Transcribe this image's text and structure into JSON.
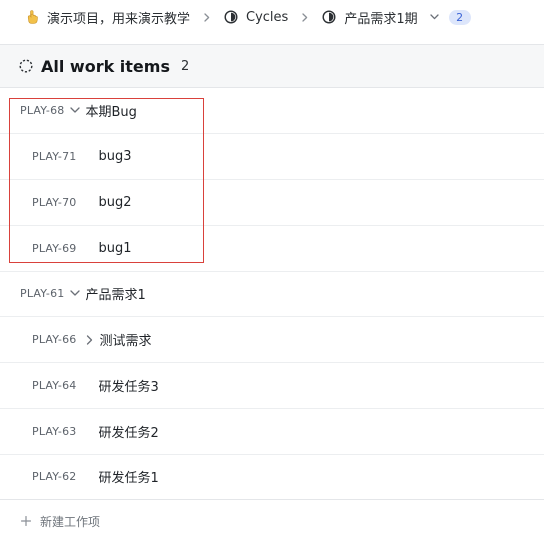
{
  "breadcrumb": {
    "project_icon": "hand-icon",
    "project": "演示项目，用来演示教学",
    "cycles": "Cycles",
    "cycle_name": "产品需求1期",
    "cycle_count": "2"
  },
  "header": {
    "title": "All work items",
    "count": "2"
  },
  "rows": [
    {
      "key": "PLAY-68",
      "label": "本期Bug",
      "toggle": "chevron-down"
    },
    {
      "key": "PLAY-71",
      "label": "bug3"
    },
    {
      "key": "PLAY-70",
      "label": "bug2"
    },
    {
      "key": "PLAY-69",
      "label": "bug1"
    },
    {
      "key": "PLAY-61",
      "label": "产品需求1",
      "toggle": "chevron-down"
    },
    {
      "key": "PLAY-66",
      "label": "测试需求",
      "toggle": "chevron-right"
    },
    {
      "key": "PLAY-64",
      "label": "研发任务3"
    },
    {
      "key": "PLAY-63",
      "label": "研发任务2"
    },
    {
      "key": "PLAY-62",
      "label": "研发任务1"
    }
  ],
  "footer": {
    "new_item": "新建工作项"
  },
  "colors": {
    "accent": "#3b63d6",
    "highlight": "#d9413b"
  }
}
